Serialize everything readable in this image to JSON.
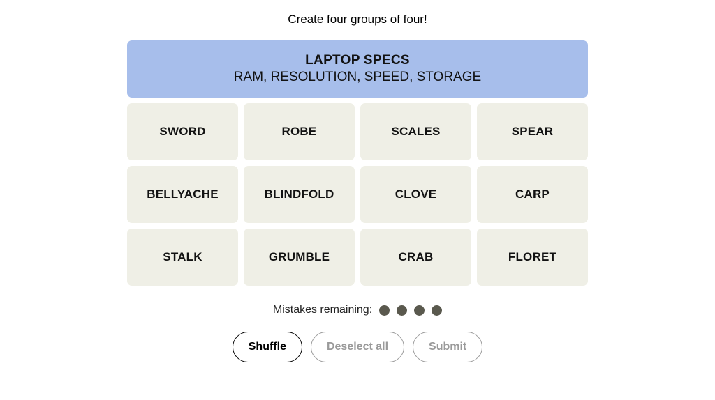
{
  "instructions": "Create four groups of four!",
  "solved": [
    {
      "category": "LAPTOP SPECS",
      "words": "RAM, RESOLUTION, SPEED, STORAGE",
      "color": "#a7beeb"
    }
  ],
  "rows": [
    [
      "SWORD",
      "ROBE",
      "SCALES",
      "SPEAR"
    ],
    [
      "BELLYACHE",
      "BLINDFOLD",
      "CLOVE",
      "CARP"
    ],
    [
      "STALK",
      "GRUMBLE",
      "CRAB",
      "FLORET"
    ]
  ],
  "mistakes": {
    "label": "Mistakes remaining:",
    "remaining": 4
  },
  "controls": {
    "shuffle": "Shuffle",
    "deselect": "Deselect all",
    "submit": "Submit"
  }
}
